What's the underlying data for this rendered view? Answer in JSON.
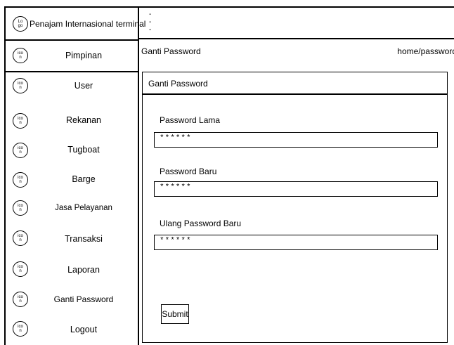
{
  "brand": {
    "logo_icon": [
      "Lo",
      "go"
    ],
    "name": "Penajam Internasional terminal"
  },
  "header": {
    "lines": [
      "-",
      "-",
      "-"
    ]
  },
  "sidebar": {
    "items": [
      {
        "label": "Pimpinan",
        "icon": [
          "ico",
          "n"
        ]
      },
      {
        "label": "User",
        "icon": [
          "ico",
          "n"
        ]
      },
      {
        "label": "Rekanan",
        "icon": [
          "ico",
          "n"
        ]
      },
      {
        "label": "Tugboat",
        "icon": [
          "ico",
          "n"
        ]
      },
      {
        "label": "Barge",
        "icon": [
          "ico",
          "n"
        ]
      },
      {
        "label": "Jasa Pelayanan",
        "icon": [
          "ico",
          "n"
        ]
      },
      {
        "label": "Transaksi",
        "icon": [
          "ico",
          "n"
        ]
      },
      {
        "label": "Laporan",
        "icon": [
          "ico",
          "n"
        ]
      },
      {
        "label": "Ganti Password",
        "icon": [
          "ico",
          "n"
        ]
      },
      {
        "label": "Logout",
        "icon": [
          "ico",
          "n"
        ]
      }
    ]
  },
  "topbar": {
    "title": "Ganti Password",
    "path": "home/password"
  },
  "panel": {
    "title": "Ganti Password",
    "fields": [
      {
        "label": "Password Lama",
        "value": "******"
      },
      {
        "label": "Password Baru",
        "value": "******"
      },
      {
        "label": "Ulang Password Baru",
        "value": "******"
      }
    ],
    "submit_label": "Submit"
  }
}
